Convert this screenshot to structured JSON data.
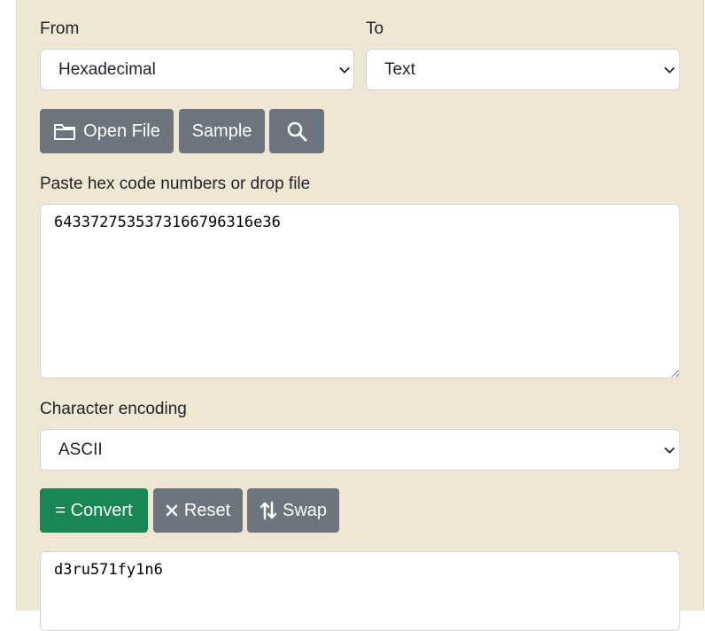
{
  "from": {
    "label": "From",
    "selected": "Hexadecimal"
  },
  "to": {
    "label": "To",
    "selected": "Text"
  },
  "file_buttons": {
    "open_file": "Open File",
    "sample": "Sample"
  },
  "input": {
    "label": "Paste hex code numbers or drop file",
    "value": "6433727535373166796316e36"
  },
  "encoding": {
    "label": "Character encoding",
    "selected": "ASCII"
  },
  "actions": {
    "convert": "= Convert",
    "reset": "Reset",
    "swap": "Swap"
  },
  "output": {
    "value": "d3ru571fy1n6"
  },
  "colors": {
    "panel_bg": "#efe7d4",
    "button_gray": "#6c757d",
    "button_green": "#198754"
  }
}
